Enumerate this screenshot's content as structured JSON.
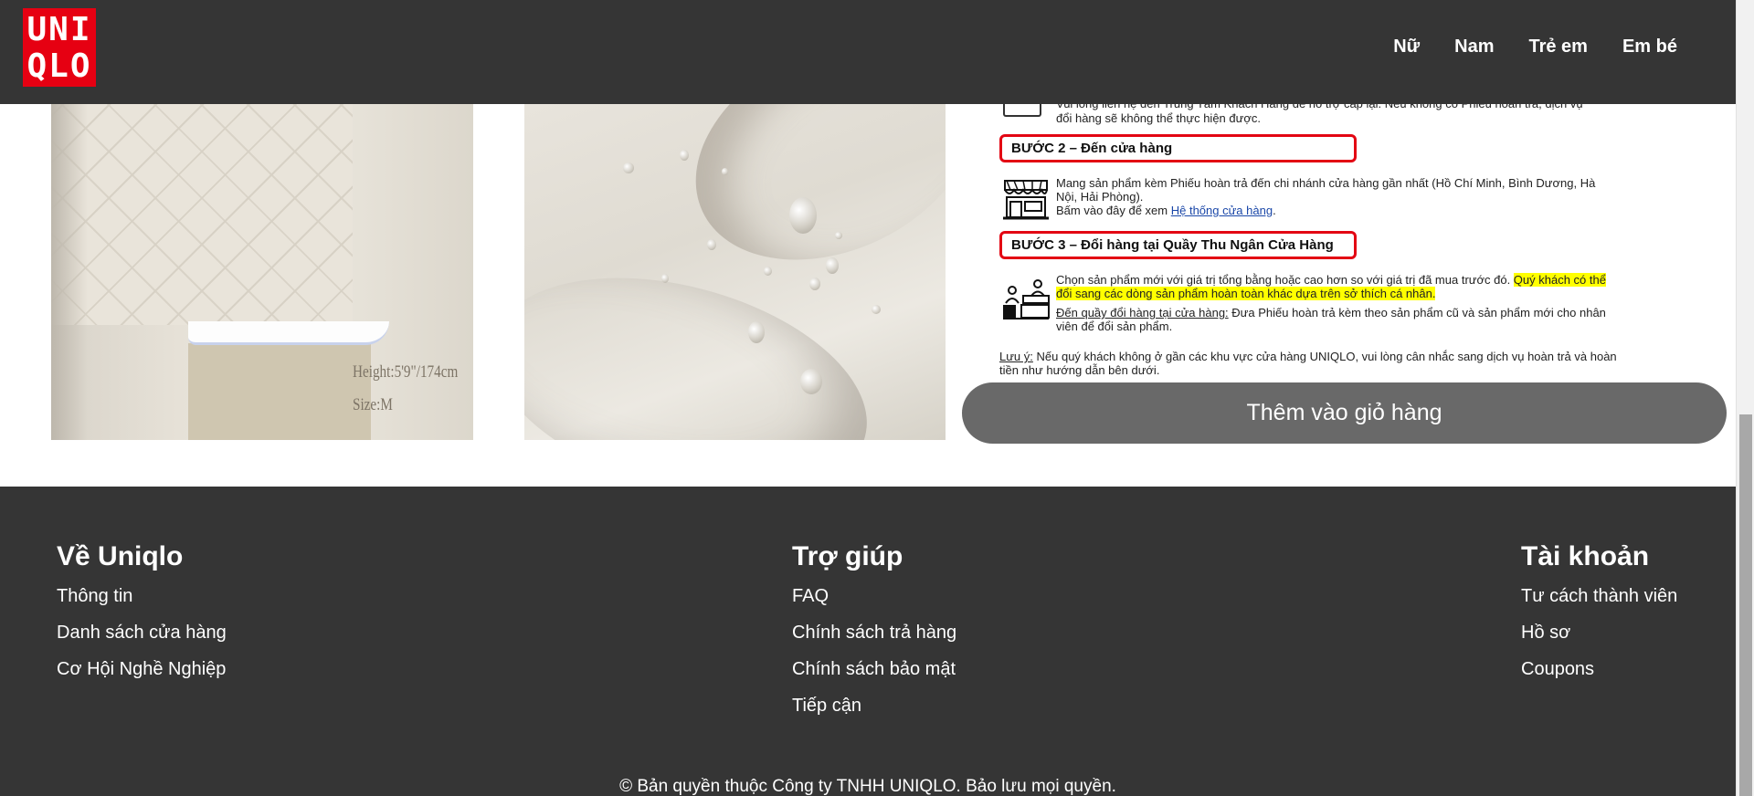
{
  "header": {
    "logo_line1": "UNI",
    "logo_line2": "QLO",
    "nav": [
      "Nữ",
      "Nam",
      "Trẻ em",
      "Em bé"
    ]
  },
  "product_images": {
    "image1_caption_height": "Height:5'9\"/174cm",
    "image1_caption_size": "Size:M"
  },
  "return_policy": {
    "cut_text_line1": "Vui lòng liên hệ đến Trung Tâm Khách Hàng để hỗ trợ cấp lại. Nếu không có Phiếu hoàn trả, dịch vụ",
    "cut_text_line2": "đổi hàng sẽ không thể thực hiện được.",
    "step2_title": "BƯỚC 2 – Đến cửa hàng",
    "step2_text": "Mang sản phẩm kèm Phiếu hoàn trả đến chi nhánh cửa hàng gần nhất (Hồ Chí Minh, Bình Dương, Hà Nội, Hải Phòng).",
    "step2_link_prefix": "Bấm vào đây để xem ",
    "step2_link": "Hệ thống cửa hàng",
    "step2_link_suffix": ".",
    "step3_title": "BƯỚC 3 – Đổi hàng tại Quầy Thu Ngân Cửa Hàng",
    "step3_text_plain": "Chọn sản phẩm mới với giá trị tổng bằng hoặc cao hơn so với giá trị đã mua trước đó. ",
    "step3_text_highlight": "Quý khách có thể đổi sang các dòng sản phẩm hoàn toàn khác dựa trên sở thích cá nhân.",
    "step3_sub_label": "Đến quầy đổi hàng tại cửa hàng:",
    "step3_sub_text": " Đưa Phiếu hoàn trả kèm theo sản phẩm cũ và sản phẩm mới cho nhân viên để đổi sản phẩm.",
    "note_label": "Lưu ý:",
    "note_text": " Nếu quý khách không ở gần các khu vực cửa hàng UNIQLO, vui lòng cân nhắc sang dịch vụ hoàn trả và hoàn tiền như hướng dẫn bên dưới."
  },
  "cart_button_label": "Thêm vào giỏ hàng",
  "footer": {
    "col1": {
      "title": "Về Uniqlo",
      "links": [
        "Thông tin",
        "Danh sách cửa hàng",
        "Cơ Hội Nghề Nghiệp"
      ]
    },
    "col2": {
      "title": "Trợ giúp",
      "links": [
        "FAQ",
        "Chính sách trả hàng",
        "Chính sách bảo mật",
        "Tiếp cận"
      ]
    },
    "col3": {
      "title": "Tài khoản",
      "links": [
        "Tư cách thành viên",
        "Hồ sơ",
        "Coupons"
      ]
    },
    "copyright": "© Bản quyền thuộc Công ty TNHH UNIQLO. Bảo lưu mọi quyền."
  },
  "colors": {
    "header_bg": "#353535",
    "logo_red": "#e60012",
    "step_border": "#e30613",
    "highlight": "#ffff00",
    "cart_button": "#696969"
  }
}
